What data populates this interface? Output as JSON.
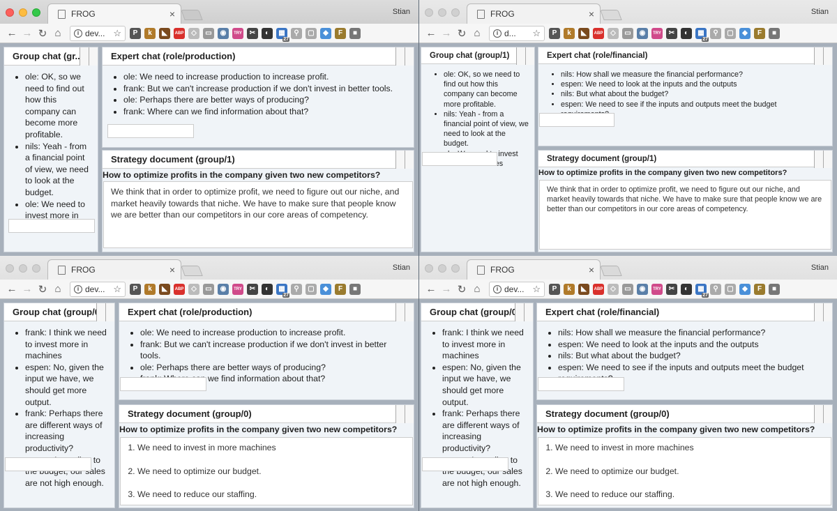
{
  "windows": [
    {
      "tab_title": "FROG",
      "profile": "Stian",
      "url": "dev...",
      "group_chat": {
        "title": "Group chat (gr...",
        "messages": [
          "ole: OK, so we need to find out how this company can become more profitable.",
          "nils: Yeah - from a financial point of view, we need to look at the budget.",
          "ole: We need to invest more in machines"
        ]
      },
      "expert_chat": {
        "title": "Expert chat (role/production)",
        "messages": [
          "ole: We need to increase production to increase profit.",
          "frank: But we can't increase production if we don't invest in better tools.",
          "ole: Perhaps there are better ways of producing?",
          "frank: Where can we find information about that?"
        ]
      },
      "strategy": {
        "title": "Strategy document (group/1)",
        "question": "How to optimize profits in the company given two new competitors?",
        "text": "We think that in order to optimize profit, we need to figure out our niche, and market heavily towards that niche. We have to make sure that people know we are better than our competitors in our core areas of competency."
      }
    },
    {
      "tab_title": "FROG",
      "profile": "Stian",
      "url": "d...",
      "group_chat": {
        "title": "Group chat (group/1)",
        "messages": [
          "ole: OK, so we need to find out how this company can become more profitable.",
          "nils: Yeah - from a financial point of view, we need to look at the budget.",
          "ole: We need to invest more in machines"
        ]
      },
      "expert_chat": {
        "title": "Expert chat (role/financial)",
        "messages": [
          "nils: How shall we measure the financial performance?",
          "espen: We need to look at the inputs and the outputs",
          "nils: But what about the budget?",
          "espen: We need to see if the inputs and outputs meet the budget requirements?"
        ]
      },
      "strategy": {
        "title": "Strategy document (group/1)",
        "question": "How to optimize profits in the company given two new competitors?",
        "text": "We think that in order to optimize profit, we need to figure out our niche, and market heavily towards that niche. We have to make sure that people know we are better than our competitors in our core areas of competency."
      }
    },
    {
      "tab_title": "FROG",
      "profile": "Stian",
      "url": "dev...",
      "group_chat": {
        "title": "Group chat (group/0)",
        "messages": [
          "frank: I think we need to invest more in machines",
          "espen: No, given the input we have, we should get more output.",
          "frank: Perhaps there are different ways of increasing productivity?",
          "espen: According to the budget, our sales are not high enough."
        ]
      },
      "expert_chat": {
        "title": "Expert chat (role/production)",
        "messages": [
          "ole: We need to increase production to increase profit.",
          "frank: But we can't increase production if we don't invest in better tools.",
          "ole: Perhaps there are better ways of producing?",
          "frank: Where can we find information about that?"
        ]
      },
      "strategy": {
        "title": "Strategy document (group/0)",
        "question": "How to optimize profits in the company given two new competitors?",
        "items": [
          "We need to invest in more machines",
          "We need to optimize our budget.",
          "We need to reduce our staffing."
        ]
      }
    },
    {
      "tab_title": "FROG",
      "profile": "Stian",
      "url": "dev...",
      "group_chat": {
        "title": "Group chat (group/0)",
        "messages": [
          "frank: I think we need to invest more in machines",
          "espen: No, given the input we have, we should get more output.",
          "frank: Perhaps there are different ways of increasing productivity?",
          "espen: According to the budget, our sales are not high enough."
        ]
      },
      "expert_chat": {
        "title": "Expert chat (role/financial)",
        "messages": [
          "nils: How shall we measure the financial performance?",
          "espen: We need to look at the inputs and the outputs",
          "nils: But what about the budget?",
          "espen: We need to see if the inputs and outputs meet the budget requirements?"
        ]
      },
      "strategy": {
        "title": "Strategy document (group/0)",
        "question": "How to optimize profits in the company given two new competitors?",
        "items": [
          "We need to invest in more machines",
          "We need to optimize our budget.",
          "We need to reduce our staffing."
        ]
      }
    }
  ],
  "extensions": [
    {
      "name": "p-icon",
      "glyph": "P",
      "color": "#555555"
    },
    {
      "name": "k-icon",
      "glyph": "k",
      "color": "#b07a2a"
    },
    {
      "name": "cat-icon",
      "glyph": "◣",
      "color": "#7a4a1e"
    },
    {
      "name": "adblock-icon",
      "glyph": "ABP",
      "color": "#d9302c"
    },
    {
      "name": "shield-icon",
      "glyph": "◇",
      "color": "#bbbbbb"
    },
    {
      "name": "comment-icon",
      "glyph": "▭",
      "color": "#999999"
    },
    {
      "name": "globe-icon",
      "glyph": "◉",
      "color": "#5a7fa8"
    },
    {
      "name": "try-icon",
      "glyph": "TRY",
      "color": "#d04a8a"
    },
    {
      "name": "tools-icon",
      "glyph": "✂",
      "color": "#444444"
    },
    {
      "name": "swirl-icon",
      "glyph": "◐",
      "color": "#333333"
    },
    {
      "name": "calendar-icon",
      "glyph": "▦",
      "color": "#3a75c4"
    },
    {
      "name": "search-icon",
      "glyph": "⚲",
      "color": "#aaaaaa"
    },
    {
      "name": "frame-icon",
      "glyph": "▢",
      "color": "#aaaaaa"
    },
    {
      "name": "diamond-icon",
      "glyph": "◆",
      "color": "#4a90d9"
    },
    {
      "name": "coin-icon",
      "glyph": "F",
      "color": "#9a7b2e"
    },
    {
      "name": "square-icon",
      "glyph": "■",
      "color": "#777777"
    }
  ]
}
